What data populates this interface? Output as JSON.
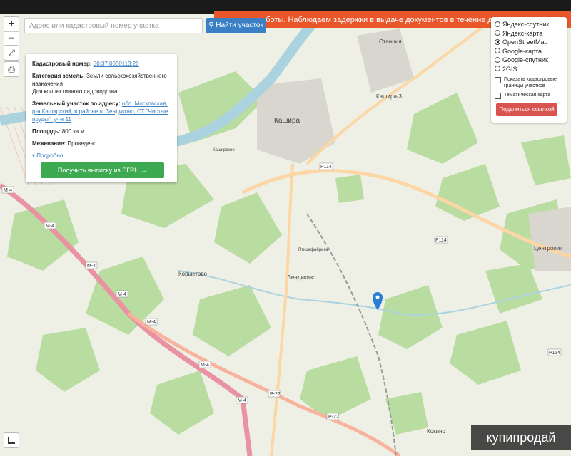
{
  "banner": {
    "text": "работы. Наблюдаем задержки в выдаче документов в течение дня."
  },
  "controls": {
    "zoom_in": "+",
    "zoom_out": "−"
  },
  "search": {
    "placeholder": "Адрес или кадастровый номер участка",
    "button_label": "Найти участок",
    "button_icon": "search-icon"
  },
  "parcel": {
    "cadastral_label": "Кадастровый номер:",
    "cadastral_value": "50:37:0030113:20",
    "category_label": "Категория земель:",
    "category_value": "Земли сельскохозяйственного назначения",
    "use_value": "Для коллективного садоводства",
    "address_label": "Земельный участок по адресу:",
    "address_value": "обл. Московская, р-н Каширский, в районе п. Зендиково, СТ \"Чистые пруды\", уч-к 11",
    "area_label": "Площадь:",
    "area_value": "800 кв.м.",
    "survey_label": "Межевание:",
    "survey_value": "Проведено",
    "more_label": "Подробно",
    "egrn_button": "Получить выписку из ЕГРН →"
  },
  "layers": {
    "options": [
      {
        "label": "Яндекс-спутник",
        "selected": false
      },
      {
        "label": "Яндекс-карта",
        "selected": false
      },
      {
        "label": "OpenStreetMap",
        "selected": true
      },
      {
        "label": "Google-карта",
        "selected": false
      },
      {
        "label": "Google-спутник",
        "selected": false
      },
      {
        "label": "2GIS",
        "selected": false
      }
    ],
    "show_borders": "Показать кадастровые границы участков",
    "thematic": "Тематическая карта",
    "share_button": "Поделиться ссылкой"
  },
  "map": {
    "places": [
      "Кашира",
      "Станция",
      "Кашира-3",
      "Зендиково",
      "Корыстово",
      "Центролит",
      "Кокино",
      "Птицефабрика",
      "Каширское"
    ],
    "roads": [
      "М-4",
      "Р-22",
      "Р114"
    ],
    "marker_color": "#2a7fd4"
  },
  "watermark": "купипродай"
}
